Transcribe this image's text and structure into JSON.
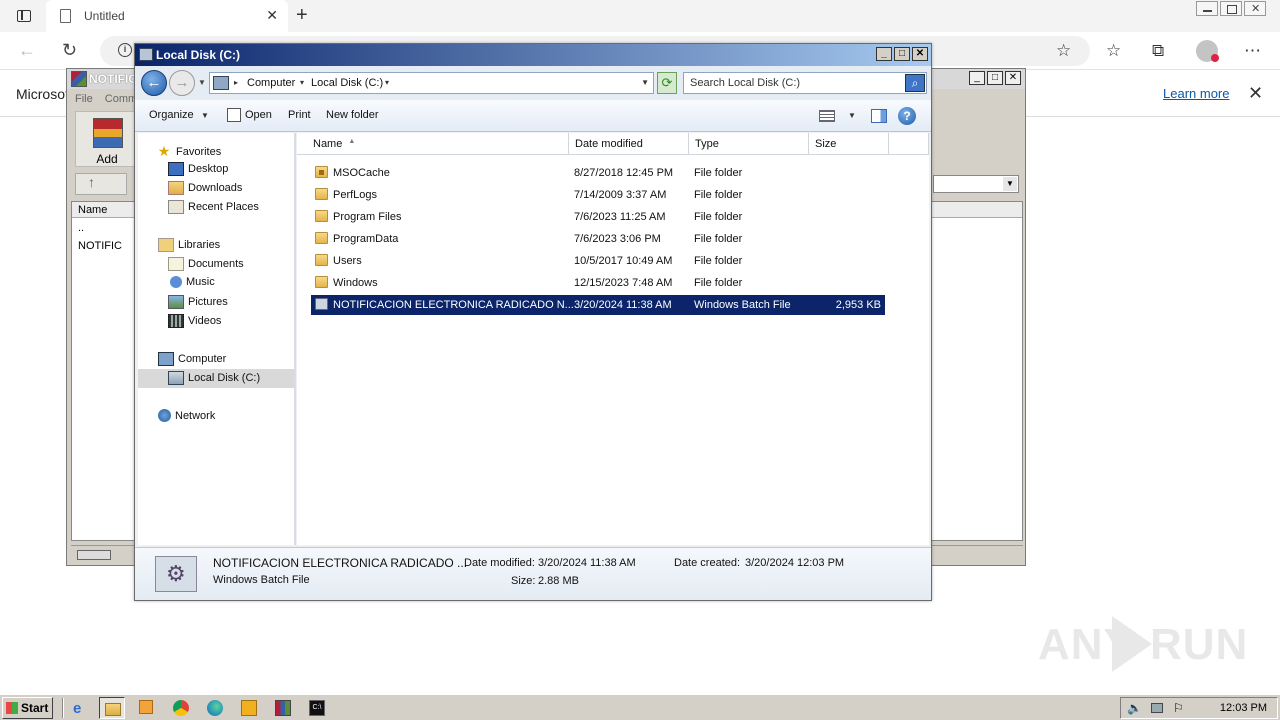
{
  "browser": {
    "tab_title": "Untitled",
    "infobar_text": "Microsof",
    "infobar_link": "Learn more"
  },
  "winrar": {
    "title": "NOTIFIC",
    "menu": [
      "File",
      "Comm"
    ],
    "add_label": "Add",
    "column_name": "Name",
    "rows": [
      "..",
      "NOTIFIC"
    ]
  },
  "explorer": {
    "title": "Local Disk (C:)",
    "breadcrumb": [
      "Computer",
      "Local Disk (C:)"
    ],
    "search_placeholder": "Search Local Disk (C:)",
    "commands": {
      "organize": "Organize",
      "open": "Open",
      "print": "Print",
      "new_folder": "New folder"
    },
    "nav": {
      "favorites": "Favorites",
      "desktop": "Desktop",
      "downloads": "Downloads",
      "recent_places": "Recent Places",
      "libraries": "Libraries",
      "documents": "Documents",
      "music": "Music",
      "pictures": "Pictures",
      "videos": "Videos",
      "computer": "Computer",
      "local_disk": "Local Disk (C:)",
      "network": "Network"
    },
    "columns": {
      "name": "Name",
      "date": "Date modified",
      "type": "Type",
      "size": "Size"
    },
    "files": [
      {
        "name": "MSOCache",
        "date": "8/27/2018 12:45 PM",
        "type": "File folder",
        "size": "",
        "icon": "locked-folder-icon"
      },
      {
        "name": "PerfLogs",
        "date": "7/14/2009 3:37 AM",
        "type": "File folder",
        "size": "",
        "icon": "folder-icon"
      },
      {
        "name": "Program Files",
        "date": "7/6/2023 11:25 AM",
        "type": "File folder",
        "size": "",
        "icon": "folder-icon"
      },
      {
        "name": "ProgramData",
        "date": "7/6/2023 3:06 PM",
        "type": "File folder",
        "size": "",
        "icon": "folder-icon"
      },
      {
        "name": "Users",
        "date": "10/5/2017 10:49 AM",
        "type": "File folder",
        "size": "",
        "icon": "folder-icon"
      },
      {
        "name": "Windows",
        "date": "12/15/2023 7:48 AM",
        "type": "File folder",
        "size": "",
        "icon": "folder-icon"
      },
      {
        "name": "NOTIFICACION ELECTRONICA RADICADO N...",
        "date": "3/20/2024 11:38 AM",
        "type": "Windows Batch File",
        "size": "2,953 KB",
        "icon": "batch-file-icon",
        "selected": true
      }
    ],
    "details": {
      "name": "NOTIFICACION ELECTRONICA RADICADO ...",
      "type": "Windows Batch File",
      "modified_label": "Date modified:",
      "modified": "3/20/2024 11:38 AM",
      "size_label": "Size:",
      "size": "2.88 MB",
      "created_label": "Date created:",
      "created": "3/20/2024 12:03 PM"
    }
  },
  "watermark": {
    "left": "ANY",
    "right": "RUN"
  },
  "taskbar": {
    "start": "Start",
    "clock": "12:03 PM"
  }
}
